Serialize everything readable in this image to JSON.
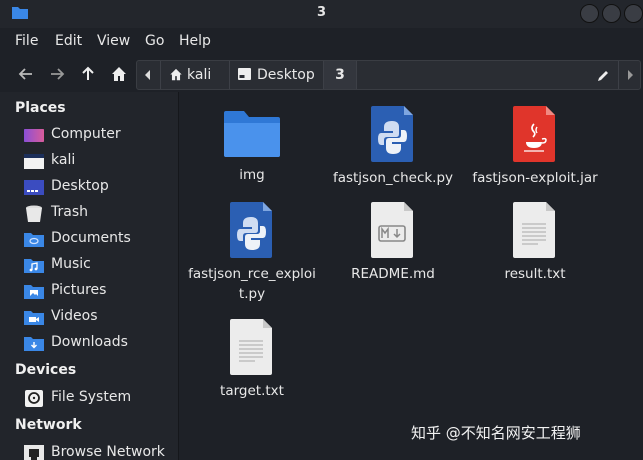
{
  "window": {
    "title": "3"
  },
  "menu": {
    "file": "File",
    "edit": "Edit",
    "view": "View",
    "go": "Go",
    "help": "Help"
  },
  "path": {
    "home": "kali",
    "desktop": "Desktop",
    "current": "3"
  },
  "sidebar": {
    "places_heading": "Places",
    "places": [
      {
        "label": "Computer",
        "icon": "computer-icon"
      },
      {
        "label": "kali",
        "icon": "home-folder-icon"
      },
      {
        "label": "Desktop",
        "icon": "desktop-icon"
      },
      {
        "label": "Trash",
        "icon": "trash-icon"
      },
      {
        "label": "Documents",
        "icon": "documents-folder-icon"
      },
      {
        "label": "Music",
        "icon": "music-folder-icon"
      },
      {
        "label": "Pictures",
        "icon": "pictures-folder-icon"
      },
      {
        "label": "Videos",
        "icon": "videos-folder-icon"
      },
      {
        "label": "Downloads",
        "icon": "downloads-folder-icon"
      }
    ],
    "devices_heading": "Devices",
    "devices": [
      {
        "label": "File System",
        "icon": "drive-icon"
      }
    ],
    "network_heading": "Network",
    "network": [
      {
        "label": "Browse Network",
        "icon": "network-icon"
      }
    ]
  },
  "files": [
    {
      "name": "img",
      "type": "folder"
    },
    {
      "name": "fastjson_check.py",
      "type": "python"
    },
    {
      "name": "fastjson-exploit.jar",
      "type": "java"
    },
    {
      "name": "fastjson_rce_exploit.py",
      "type": "python"
    },
    {
      "name": "README.md",
      "type": "markdown"
    },
    {
      "name": "result.txt",
      "type": "text"
    },
    {
      "name": "target.txt",
      "type": "text"
    }
  ],
  "watermark": "知乎 @不知名网安工程狮",
  "colors": {
    "folder_blue": "#3a87e6",
    "python_blue": "#2d63b8",
    "java_red": "#e03a2e",
    "doc_white": "#f0f0f0"
  }
}
